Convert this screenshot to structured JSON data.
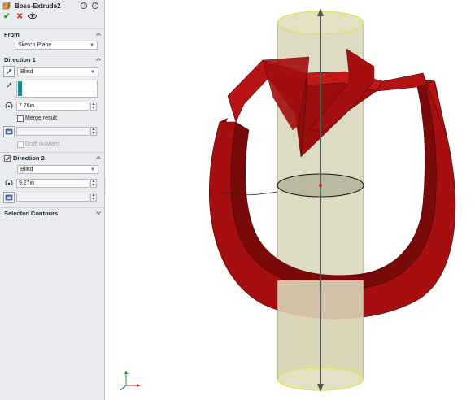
{
  "feature": {
    "title": "Boss-Extrude2",
    "icons": [
      "boss-extrude-icon",
      "help-icon",
      "help-icon",
      "ok-icon",
      "cancel-icon",
      "detailed-preview-icon"
    ]
  },
  "from": {
    "section_title": "From",
    "value": "Sketch Plane"
  },
  "direction1": {
    "section_title": "Direction 1",
    "end_condition": "Blind",
    "depth": "7.76in",
    "merge_result_label": "Merge result",
    "merge_result_checked": false,
    "draft_outward_label": "Draft outward",
    "selection_color": "#1a8a82"
  },
  "direction2": {
    "section_title": "Direction 2",
    "enabled": true,
    "end_condition": "Blind",
    "depth": "9.27in"
  },
  "selected_contours": {
    "section_title": "Selected Contours"
  },
  "colors": {
    "panel_bg": "#e9ebee",
    "extrude_red": "#a50f0f",
    "cylinder_fill": "#d8d5b8",
    "cylinder_edge": "#e6e04a"
  }
}
